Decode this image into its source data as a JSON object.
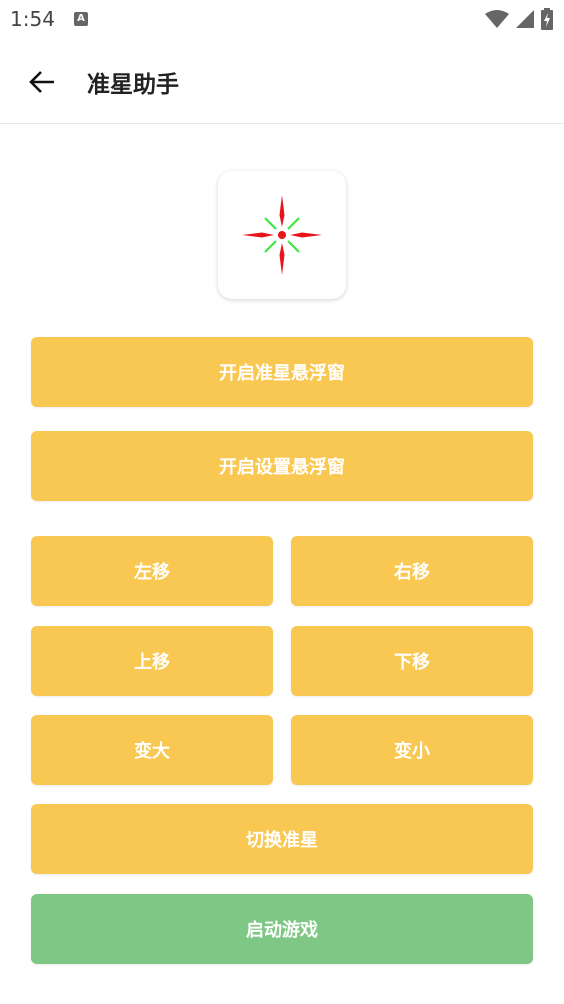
{
  "status_bar": {
    "time": "1:54",
    "app_icon_letter": "A"
  },
  "app_bar": {
    "title": "准星助手"
  },
  "buttons": {
    "open_crosshair_overlay": "开启准星悬浮窗",
    "open_settings_overlay": "开启设置悬浮窗",
    "move_left": "左移",
    "move_right": "右移",
    "move_up": "上移",
    "move_down": "下移",
    "enlarge": "变大",
    "shrink": "变小",
    "switch_crosshair": "切换准星",
    "launch_game": "启动游戏"
  },
  "colors": {
    "primary_button": "#f9c853",
    "launch_button": "#7ec784",
    "crosshair_red": "#e8141b",
    "crosshair_green": "#39e639"
  }
}
